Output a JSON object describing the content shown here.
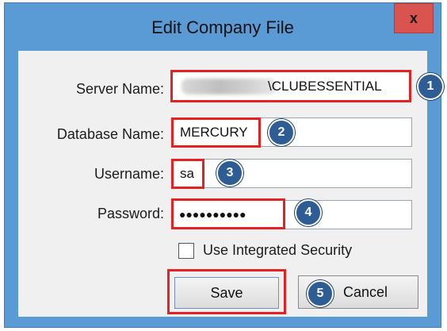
{
  "window": {
    "title": "Edit Company File",
    "close_label": "x"
  },
  "form": {
    "server_label": "Server Name:",
    "server_value": "\\CLUBESSENTIAL",
    "database_label": "Database Name:",
    "database_value": "MERCURY",
    "username_label": "Username:",
    "username_value": "sa",
    "password_label": "Password:",
    "password_value": "●●●●●●●●●●",
    "integrated_security_label": "Use Integrated Security",
    "integrated_security_checked": false
  },
  "buttons": {
    "save_label": "Save",
    "cancel_label": "Cancel"
  },
  "callouts": [
    "1",
    "2",
    "3",
    "4",
    "5"
  ],
  "colors": {
    "highlight": "#e52222",
    "badge": "#2e5d96",
    "frame": "#5b9bd5",
    "close": "#d9534f"
  }
}
